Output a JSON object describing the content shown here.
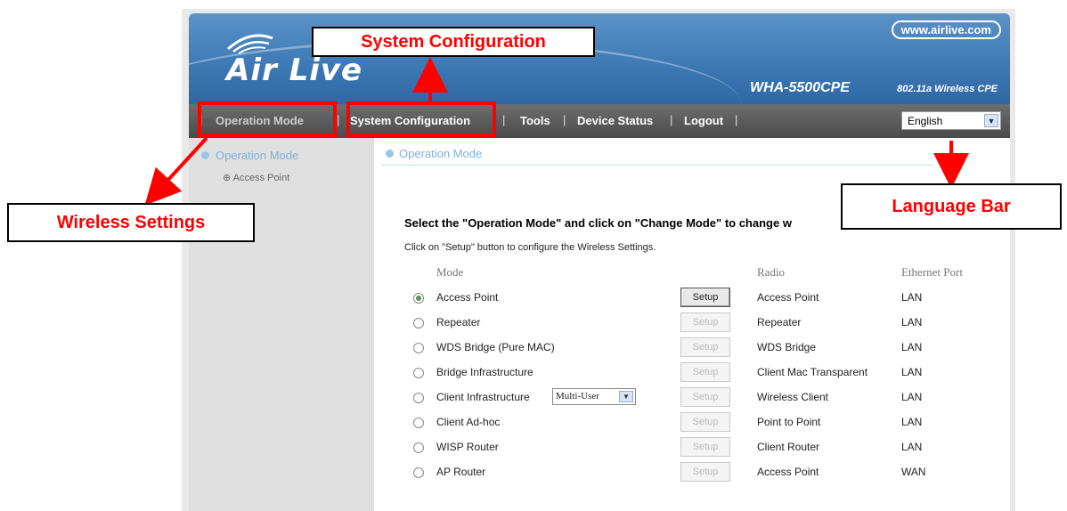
{
  "header": {
    "logo_text": "Air Live",
    "url": "www.airlive.com",
    "model": "WHA-5500CPE",
    "model_desc": "802.11a Wireless CPE"
  },
  "nav": {
    "items": [
      "Operation Mode",
      "System Configuration",
      "Tools",
      "Device Status",
      "Logout"
    ],
    "separator": "|",
    "language": "English"
  },
  "sidebar": {
    "heading": "Operation Mode",
    "item": "Access Point"
  },
  "content": {
    "tab_title": "Operation Mode",
    "instruction_bold": "Select the \"Operation Mode\" and click on \"Change Mode\" to change w",
    "instruction": "Click on \"Setup\" button to configure the Wireless Settings.",
    "columns": {
      "mode": "Mode",
      "radio": "Radio",
      "ethernet": "Ethernet Port"
    },
    "setup_label": "Setup",
    "client_select_value": "Multi-User",
    "rows": [
      {
        "mode": "Access Point",
        "radio": "Access Point",
        "eth": "LAN",
        "selected": true,
        "setup_enabled": true
      },
      {
        "mode": "Repeater",
        "radio": "Repeater",
        "eth": "LAN",
        "selected": false,
        "setup_enabled": false
      },
      {
        "mode": "WDS Bridge (Pure MAC)",
        "radio": "WDS Bridge",
        "eth": "LAN",
        "selected": false,
        "setup_enabled": false
      },
      {
        "mode": "Bridge Infrastructure",
        "radio": "Client Mac Transparent",
        "eth": "LAN",
        "selected": false,
        "setup_enabled": false
      },
      {
        "mode": "Client Infrastructure",
        "radio": "Wireless Client",
        "eth": "LAN",
        "selected": false,
        "setup_enabled": false
      },
      {
        "mode": "Client Ad-hoc",
        "radio": "Point to Point",
        "eth": "LAN",
        "selected": false,
        "setup_enabled": false
      },
      {
        "mode": "WISP Router",
        "radio": "Client Router",
        "eth": "LAN",
        "selected": false,
        "setup_enabled": false
      },
      {
        "mode": "AP Router",
        "radio": "Access Point",
        "eth": "WAN",
        "selected": false,
        "setup_enabled": false
      }
    ]
  },
  "annotations": {
    "system_configuration": "System Configuration",
    "wireless_settings": "Wireless Settings",
    "language_bar": "Language Bar",
    "color": "#ff0000"
  }
}
